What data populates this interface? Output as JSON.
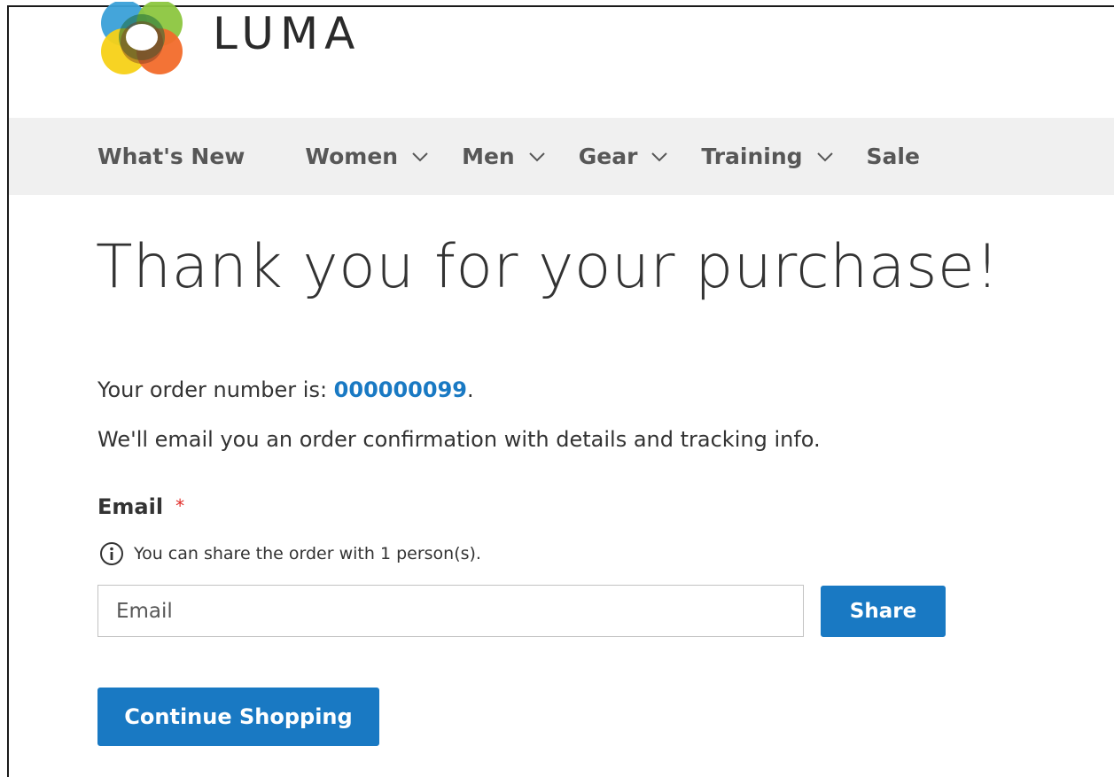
{
  "header": {
    "logo_text": "LUMA"
  },
  "nav": {
    "items": [
      {
        "label": "What's New",
        "has_dropdown": false
      },
      {
        "label": "Women",
        "has_dropdown": true
      },
      {
        "label": "Men",
        "has_dropdown": true
      },
      {
        "label": "Gear",
        "has_dropdown": true
      },
      {
        "label": "Training",
        "has_dropdown": true
      },
      {
        "label": "Sale",
        "has_dropdown": false
      }
    ]
  },
  "main": {
    "title": "Thank you for your purchase!",
    "order_prefix": "Your order number is: ",
    "order_number": "000000099",
    "order_suffix": ".",
    "email_notice": "We'll email you an order confirmation with details and tracking info.",
    "share": {
      "email_label": "Email",
      "required_mark": "*",
      "note": "You can share the order with 1 person(s).",
      "email_placeholder": "Email",
      "email_value": "",
      "share_button": "Share"
    },
    "continue_button": "Continue Shopping"
  },
  "colors": {
    "accent": "#1979c3",
    "nav_background": "#f0f0f0",
    "required": "#e02b27",
    "text": "#333333"
  },
  "icons": {
    "logo": "luma-logo-icon",
    "dropdown": "chevron-down-icon",
    "info": "info-icon"
  }
}
